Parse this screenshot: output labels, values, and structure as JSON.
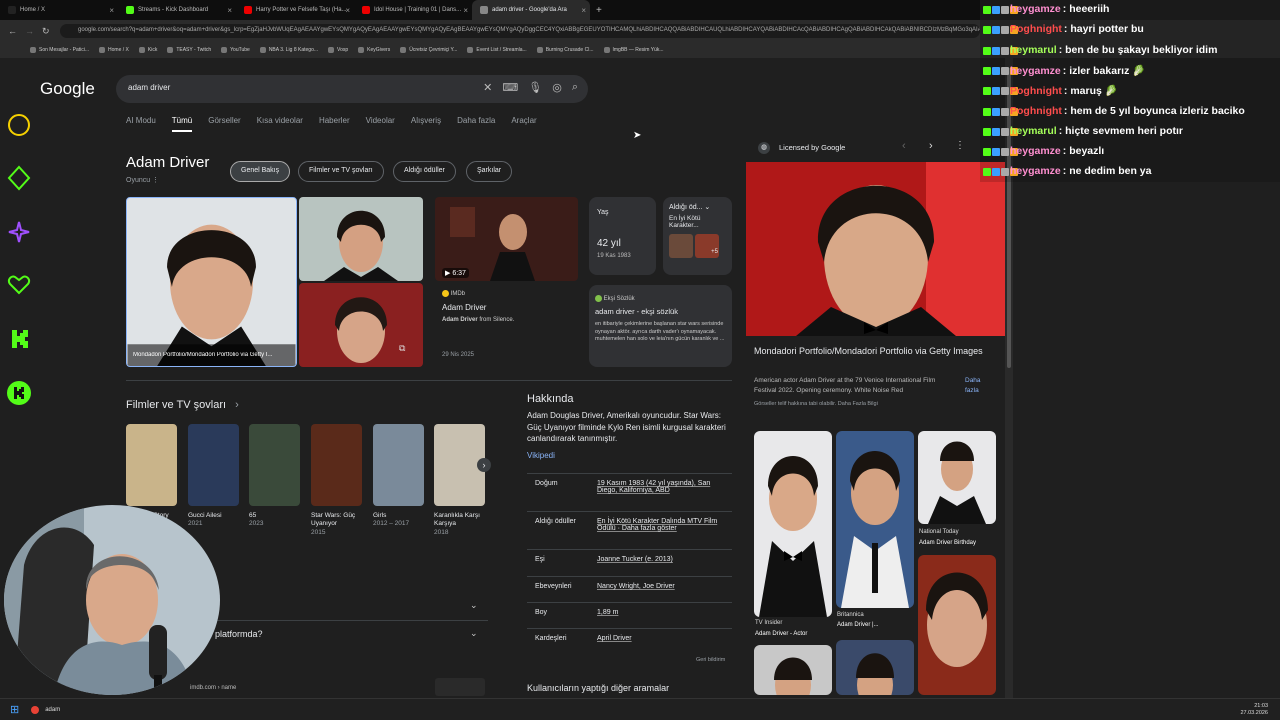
{
  "browser": {
    "tabs": [
      {
        "label": "Home / X",
        "color": "#222"
      },
      {
        "label": "Streams - Kick Dashboard",
        "color": "#53fc18"
      },
      {
        "label": "Harry Potter ve Felsefe Taşı (Ha...",
        "color": "#e00"
      },
      {
        "label": "Idol House | Training 01 | Dans...",
        "color": "#e00"
      },
      {
        "label": "adam driver - Google'da Ara",
        "color": "#888"
      }
    ],
    "url": "google.com/search?q=adam+driver&oq=adam+driver&gs_lcrp=EgZjaHJvbWUqEAgAEAAYgwEYsQMYgAQyEAgAEAAYgwEYsQMYgAQyEAgBEAAYgwEYsQMYgAQyDggCEC4YQxiABBgEGEUYOTIHCAMQLhiABDIHCAQQABiABDIHCAUQLhiABDIHCAYQABiABDIHCAcQABiABDIHCAgQABiABDIHCAkQABiABNIBCDIzMzBqMGo3qAIAsAIA",
    "bookmarks": [
      "Son Mesajlar - Patici...",
      "Home / X",
      "Kick",
      "TEASY - Twitch",
      "YouTube",
      "NBA 3. Lig 8 Katego...",
      "Vosp",
      "KeyGivers",
      "Ücretsiz Çevrimiçi Y...",
      "Event List / Streamla...",
      "Burning Crusade Cl...",
      "ImgBB — Resim Yük..."
    ]
  },
  "google": {
    "logo": "Google",
    "query": "adam driver",
    "tabs": [
      "AI Modu",
      "Tümü",
      "Görseller",
      "Kısa videolar",
      "Haberler",
      "Videolar",
      "Alışveriş",
      "Daha fazla",
      "Araçlar"
    ],
    "kp": {
      "title": "Adam Driver",
      "subtitle": "Oyuncu",
      "chips": [
        "Genel Bakış",
        "Filmler ve TV şovları",
        "Aldığı ödüller",
        "Şarkılar"
      ],
      "caption": "Mondadori Portfolio/Mondadori Portfolio via Getty I...",
      "video": {
        "duration": "6:37",
        "source": "IMDb",
        "title": "Adam Driver",
        "desc_bold": "Adam Driver",
        "desc": " from Silence.",
        "date": "29 Nis 2025"
      },
      "age": {
        "label": "Yaş",
        "value": "42 yıl",
        "date": "19 Kas 1983"
      },
      "awards": {
        "label": "Aldığı öd...",
        "text": "En İyi Kötü Karakter...",
        "more": "+5"
      },
      "eksi": {
        "source": "Ekşi Sözlük",
        "title": "adam driver - ekşi sözlük",
        "text": "en itibariyle çekimlerine başlanan star wars serisinde oynayan aktör. ayrıca darth vader'ı oynamayacak. muhtemelen han solo ve leia'nın gücün karanlık ve ..."
      }
    },
    "films": {
      "title": "Filmler ve TV şovları",
      "items": [
        {
          "title": "Marriage Story",
          "year": "",
          "color": "#c9b48a"
        },
        {
          "title": "Gucci Ailesi",
          "year": "2021",
          "color": "#2a3a5a"
        },
        {
          "title": "65",
          "year": "2023",
          "color": "#3a4a3a"
        },
        {
          "title": "Star Wars: Güç Uyanıyor",
          "year": "2015",
          "color": "#5a2a1a"
        },
        {
          "title": "Girls",
          "year": "2012 – 2017",
          "color": "#7a8a9a"
        },
        {
          "title": "Karanlıkla Karşı Karşıya",
          "year": "2018",
          "color": "#c8c0b0"
        }
      ]
    },
    "about": {
      "title": "Hakkında",
      "text": "Adam Douglas Driver, Amerikalı oyuncudur. Star Wars: Güç Uyanıyor filminde Kylo Ren isimli kurgusal karakteri canlandırarak tanınmıştır.",
      "link": "Vikipedi",
      "rows": [
        {
          "k": "Doğum",
          "v": "19 Kasım 1983 (42 yıl yaşında), San Diego, Kaliforniya, ABD"
        },
        {
          "k": "Aldığı ödüller",
          "v": "En İyi Kötü Karakter Dalında MTV Film Ödülü · Daha fazla göster"
        },
        {
          "k": "Eşi",
          "v": "Joanne Tucker (e. 2013)"
        },
        {
          "k": "Ebeveynleri",
          "v": "Nancy Wright, Joe Driver"
        },
        {
          "k": "Boy",
          "v": "1,89 m"
        },
        {
          "k": "Kardeşleri",
          "v": "April Driver"
        }
      ],
      "feedback": "Geri bildirim",
      "other": "Kullanıcıların yaptığı diğer aramalar"
    },
    "qa": {
      "text": "platformda?",
      "source": "imdb.com › name"
    },
    "preview": {
      "licensed": "Licensed by Google",
      "title": "Mondadori Portfolio/Mondadori Portfolio via Getty Images",
      "desc": "American actor Adam Driver at the 79 Venice International Film Festival 2022. Opening ceremony. White Noise Red",
      "more": "Daha fazla",
      "rights": "Görseller telif hakkına tabi olabilir. Daha Fazla Bilgi",
      "related": [
        {
          "source": "TV Insider",
          "title": "Adam Driver - Actor"
        },
        {
          "source": "Britannica",
          "title": "Adam Driver |..."
        },
        {
          "source": "National Today",
          "title": "Adam Driver Birthday"
        }
      ]
    }
  },
  "chat": [
    {
      "user": "heygamze",
      "color": "#ff8fd0",
      "text": "heeeriih"
    },
    {
      "user": "Poghnight",
      "color": "#ff4d4d",
      "text": "hayri potter bu"
    },
    {
      "user": "heymarul",
      "color": "#a6ff5a",
      "text": "ben de bu şakayı bekliyor idim"
    },
    {
      "user": "heygamze",
      "color": "#ff8fd0",
      "text": "izler bakarız 🥬"
    },
    {
      "user": "Poghnight",
      "color": "#ff4d4d",
      "text": "maruş 🥬"
    },
    {
      "user": "Poghnight",
      "color": "#ff4d4d",
      "text": "hem de 5 yıl boyunca izleriz baciko"
    },
    {
      "user": "heymarul",
      "color": "#a6ff5a",
      "text": "hiçte sevmem heri potır"
    },
    {
      "user": "heygamze",
      "color": "#ff8fd0",
      "text": "beyazlı"
    },
    {
      "user": "heygamze",
      "color": "#ff8fd0",
      "text": "ne dedim ben ya"
    }
  ],
  "taskbar": {
    "search": "adam",
    "time": "21:03",
    "date": "27.03.2026"
  }
}
